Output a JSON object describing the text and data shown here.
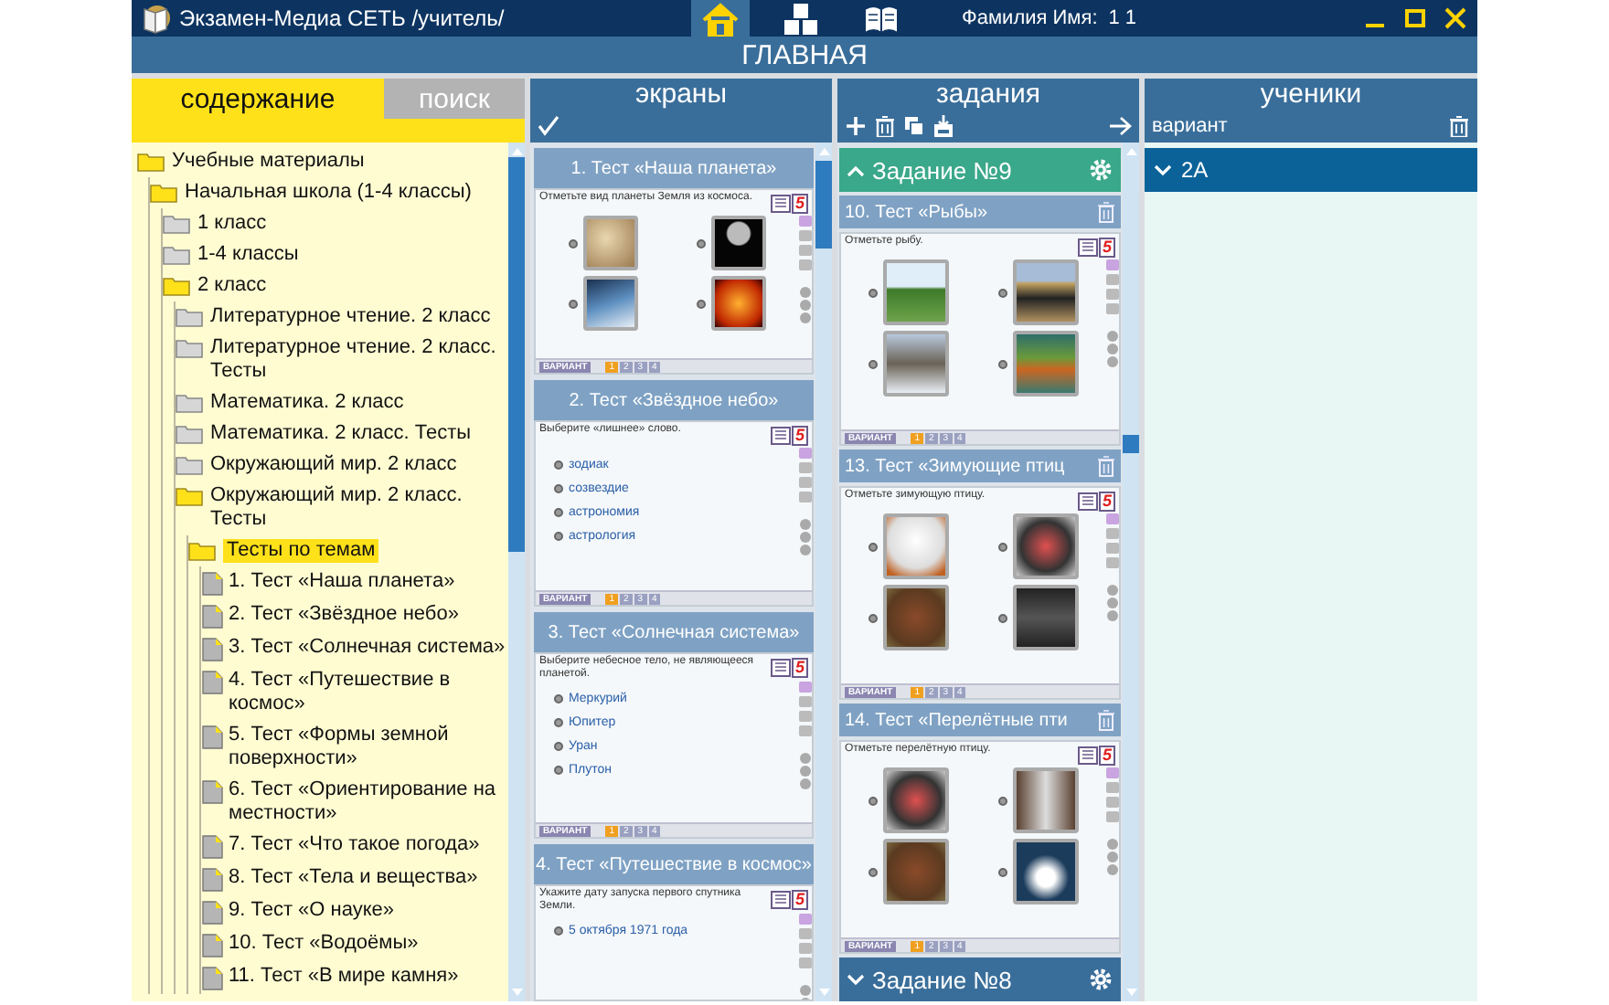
{
  "window": {
    "title": "Экзамен-Медиа СЕТЬ /учитель/",
    "user_label": "Фамилия Имя:",
    "user_value": "1 1"
  },
  "nav": [
    {
      "kind": "home",
      "selected": true
    },
    {
      "kind": "blocks",
      "selected": false
    },
    {
      "kind": "book",
      "selected": false
    }
  ],
  "page_title": "ГЛАВНАЯ",
  "left_tabs": [
    {
      "label": "содержание",
      "selected": true
    },
    {
      "label": "поиск",
      "selected": false
    }
  ],
  "tree": [
    {
      "label": "Учебные материалы",
      "kind": "folder",
      "expanded": true,
      "selected": false,
      "children": [
        {
          "label": "Начальная школа (1-4 классы)",
          "kind": "folder",
          "expanded": true,
          "selected": false,
          "children": [
            {
              "label": "1 класс",
              "kind": "folder",
              "expanded": false,
              "selected": false
            },
            {
              "label": "1-4 классы",
              "kind": "folder",
              "expanded": false,
              "selected": false
            },
            {
              "label": "2 класс",
              "kind": "folder",
              "expanded": true,
              "selected": false,
              "children": [
                {
                  "label": "Литературное чтение. 2 класс",
                  "kind": "folder",
                  "expanded": false,
                  "selected": false
                },
                {
                  "label": "Литературное чтение. 2 класс. Тесты",
                  "kind": "folder",
                  "expanded": false,
                  "selected": false
                },
                {
                  "label": "Математика. 2 класс",
                  "kind": "folder",
                  "expanded": false,
                  "selected": false
                },
                {
                  "label": "Математика. 2 класс. Тесты",
                  "kind": "folder",
                  "expanded": false,
                  "selected": false
                },
                {
                  "label": "Окружающий мир. 2 класс",
                  "kind": "folder",
                  "expanded": false,
                  "selected": false
                },
                {
                  "label": "Окружающий мир. 2 класс. Тесты",
                  "kind": "folder",
                  "expanded": true,
                  "selected": false,
                  "children": [
                    {
                      "label": "Тесты по темам",
                      "kind": "folder",
                      "expanded": true,
                      "selected": true,
                      "children": [
                        {
                          "label": "1. Тест «Наша планета»",
                          "kind": "test",
                          "selected": false
                        },
                        {
                          "label": "2. Тест «Звёздное небо»",
                          "kind": "test",
                          "selected": false
                        },
                        {
                          "label": "3. Тест «Солнечная система»",
                          "kind": "test",
                          "selected": false
                        },
                        {
                          "label": "4. Тест «Путешествие в космос»",
                          "kind": "test",
                          "selected": false
                        },
                        {
                          "label": "5. Тест «Формы земной поверхности»",
                          "kind": "test",
                          "selected": false
                        },
                        {
                          "label": "6. Тест «Ориентирование на местности»",
                          "kind": "test",
                          "selected": false
                        },
                        {
                          "label": "7. Тест «Что такое погода»",
                          "kind": "test",
                          "selected": false
                        },
                        {
                          "label": "8. Тест «Тела и вещества»",
                          "kind": "test",
                          "selected": false
                        },
                        {
                          "label": "9. Тест «О науке»",
                          "kind": "test",
                          "selected": false
                        },
                        {
                          "label": "10. Тест «Водоёмы»",
                          "kind": "test",
                          "selected": false
                        },
                        {
                          "label": "11. Тест «В мире камня»",
                          "kind": "test",
                          "selected": false
                        }
                      ]
                    }
                  ]
                }
              ]
            }
          ]
        }
      ]
    }
  ],
  "screens": {
    "title": "экраны",
    "items": [
      {
        "title": "1. Тест «Наша планета»",
        "preview": {
          "kind": "pictures",
          "question": "Отметьте вид планеты Земля из космоса.",
          "grade": "5",
          "answers": [
            {
              "selected": false
            },
            {
              "selected": false
            },
            {
              "selected": false
            },
            {
              "selected": false
            }
          ],
          "variant_label": "ВАРИАНТ",
          "variants": [
            {
              "label": "1",
              "selected": true
            },
            {
              "label": "2",
              "selected": false
            },
            {
              "label": "3",
              "selected": false
            },
            {
              "label": "4",
              "selected": false
            }
          ]
        }
      },
      {
        "title": "2. Тест «Звёздное небо»",
        "preview": {
          "kind": "choices",
          "question": "Выберите «лишнее» слово.",
          "grade": "5",
          "answers": [
            {
              "text": "зодиак",
              "selected": false
            },
            {
              "text": "созвездие",
              "selected": false
            },
            {
              "text": "астрономия",
              "selected": false
            },
            {
              "text": "астрология",
              "selected": false
            }
          ],
          "variant_label": "ВАРИАНТ",
          "variants": [
            {
              "label": "1",
              "selected": true
            },
            {
              "label": "2",
              "selected": false
            },
            {
              "label": "3",
              "selected": false
            },
            {
              "label": "4",
              "selected": false
            }
          ]
        }
      },
      {
        "title": "3. Тест «Солнечная система»",
        "preview": {
          "kind": "choices",
          "question": "Выберите небесное тело, не являющееся планетой.",
          "grade": "5",
          "answers": [
            {
              "text": "Меркурий",
              "selected": false
            },
            {
              "text": "Юпитер",
              "selected": false
            },
            {
              "text": "Уран",
              "selected": false
            },
            {
              "text": "Плутон",
              "selected": false
            }
          ],
          "variant_label": "ВАРИАНТ",
          "variants": [
            {
              "label": "1",
              "selected": true
            },
            {
              "label": "2",
              "selected": false
            },
            {
              "label": "3",
              "selected": false
            },
            {
              "label": "4",
              "selected": false
            }
          ]
        }
      },
      {
        "title": "4. Тест «Путешествие в космос»",
        "preview": {
          "kind": "choices",
          "question": "Укажите дату запуска первого спутника Земли.",
          "grade": "5",
          "answers": [
            {
              "text": "5 октября 1971 года",
              "selected": false
            }
          ]
        }
      }
    ]
  },
  "tasks": {
    "title": "задания",
    "groups": [
      {
        "title": "Задание №9",
        "expanded": true,
        "selected": true,
        "items": [
          {
            "title": "10. Тест «Рыбы»",
            "preview": {
              "kind": "pictures",
              "question": "Отметьте рыбу.",
              "grade": "5",
              "answers": [
                {
                  "selected": false
                },
                {
                  "selected": false
                },
                {
                  "selected": false
                },
                {
                  "selected": false
                }
              ],
              "variant_label": "ВАРИАНТ",
              "variants": [
                {
                  "label": "1",
                  "selected": true
                },
                {
                  "label": "2",
                  "selected": false
                },
                {
                  "label": "3",
                  "selected": false
                },
                {
                  "label": "4",
                  "selected": false
                }
              ]
            }
          },
          {
            "title": "13. Тест «Зимующие птиц",
            "preview": {
              "kind": "pictures",
              "question": "Отметьте зимующую птицу.",
              "grade": "5",
              "answers": [
                {
                  "selected": false
                },
                {
                  "selected": false
                },
                {
                  "selected": false
                },
                {
                  "selected": false
                }
              ],
              "variant_label": "ВАРИАНТ",
              "variants": [
                {
                  "label": "1",
                  "selected": true
                },
                {
                  "label": "2",
                  "selected": false
                },
                {
                  "label": "3",
                  "selected": false
                },
                {
                  "label": "4",
                  "selected": false
                }
              ]
            }
          },
          {
            "title": "14. Тест «Перелётные пти",
            "preview": {
              "kind": "pictures",
              "question": "Отметьте перелётную птицу.",
              "grade": "5",
              "answers": [
                {
                  "selected": false
                },
                {
                  "selected": false
                },
                {
                  "selected": false
                },
                {
                  "selected": false
                }
              ],
              "variant_label": "ВАРИАНТ",
              "variants": [
                {
                  "label": "1",
                  "selected": true
                },
                {
                  "label": "2",
                  "selected": false
                },
                {
                  "label": "3",
                  "selected": false
                },
                {
                  "label": "4",
                  "selected": false
                }
              ]
            }
          }
        ]
      },
      {
        "title": "Задание №8",
        "expanded": false,
        "selected": false
      }
    ]
  },
  "students": {
    "title": "ученики",
    "filter_label": "вариант",
    "groups": [
      {
        "label": "2А",
        "expanded": false
      }
    ]
  }
}
